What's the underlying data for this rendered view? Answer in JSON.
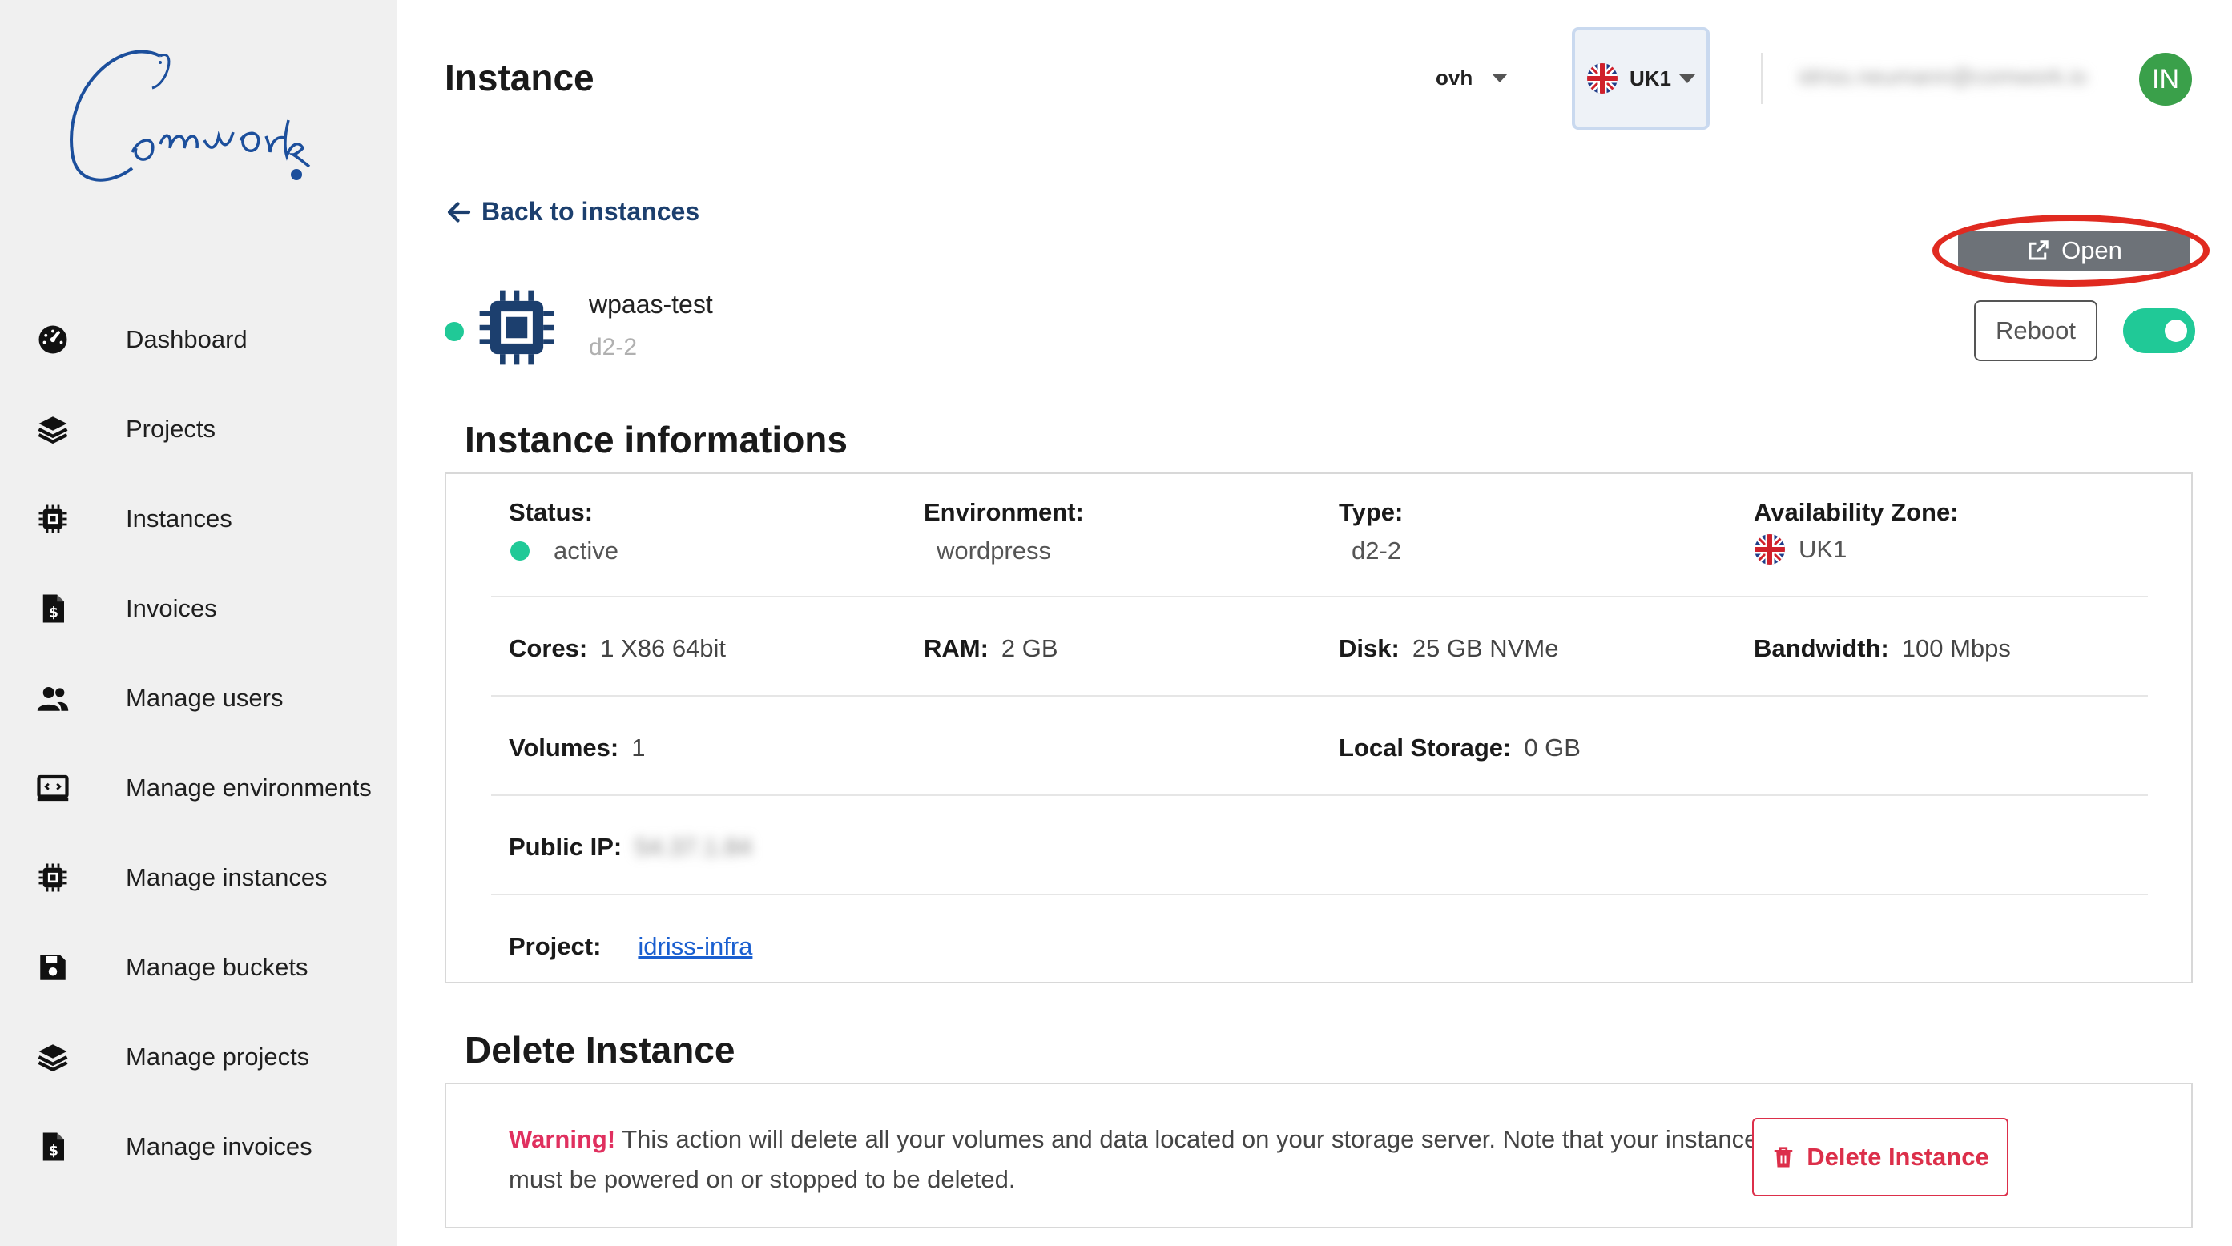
{
  "sidebar": {
    "logo_text": "Comwork",
    "items": [
      {
        "label": "Dashboard",
        "icon": "dashboard-gauge-icon"
      },
      {
        "label": "Projects",
        "icon": "layers-icon"
      },
      {
        "label": "Instances",
        "icon": "chip-icon"
      },
      {
        "label": "Invoices",
        "icon": "invoice-icon"
      },
      {
        "label": "Manage users",
        "icon": "users-icon"
      },
      {
        "label": "Manage environments",
        "icon": "code-screen-icon"
      },
      {
        "label": "Manage instances",
        "icon": "chip-icon"
      },
      {
        "label": "Manage buckets",
        "icon": "floppy-disk-icon"
      },
      {
        "label": "Manage projects",
        "icon": "layers-icon"
      },
      {
        "label": "Manage invoices",
        "icon": "invoice-icon"
      }
    ]
  },
  "header": {
    "title": "Instance",
    "provider": "ovh",
    "region": "UK1",
    "user_email": "idriss.neumann@comwork.io",
    "avatar_initials": "IN",
    "avatar_color": "#3aa04a"
  },
  "back_link": "Back to instances",
  "instance": {
    "name": "wpaas-test",
    "type": "d2-2",
    "status_color": "#20c997"
  },
  "actions": {
    "open_label": "Open",
    "reboot_label": "Reboot",
    "power_on": true
  },
  "info": {
    "section_title": "Instance informations",
    "status_label": "Status:",
    "status_value": "active",
    "environment_label": "Environment:",
    "environment_value": "wordpress",
    "type_label": "Type:",
    "type_value": "d2-2",
    "zone_label": "Availability Zone:",
    "zone_value": "UK1",
    "cores_label": "Cores:",
    "cores_value": "1 X86 64bit",
    "ram_label": "RAM:",
    "ram_value": "2 GB",
    "disk_label": "Disk:",
    "disk_value": "25 GB NVMe",
    "bandwidth_label": "Bandwidth:",
    "bandwidth_value": "100 Mbps",
    "volumes_label": "Volumes:",
    "volumes_value": "1",
    "local_storage_label": "Local Storage:",
    "local_storage_value": "0 GB",
    "public_ip_label": "Public IP:",
    "public_ip_value": "54.37.1.84",
    "project_label": "Project:",
    "project_value": "idriss-infra"
  },
  "delete": {
    "section_title": "Delete Instance",
    "warning_prefix": "Warning!",
    "warning_text": "This action will delete all your volumes and data located on your storage server. Note that your instance must be powered on or stopped to be deleted.",
    "button_label": "Delete Instance"
  },
  "colors": {
    "accent_green": "#20c997",
    "danger_red": "#dc2f4a",
    "nav_blue": "#1c3f6e",
    "annotation_red": "#e02a20"
  }
}
